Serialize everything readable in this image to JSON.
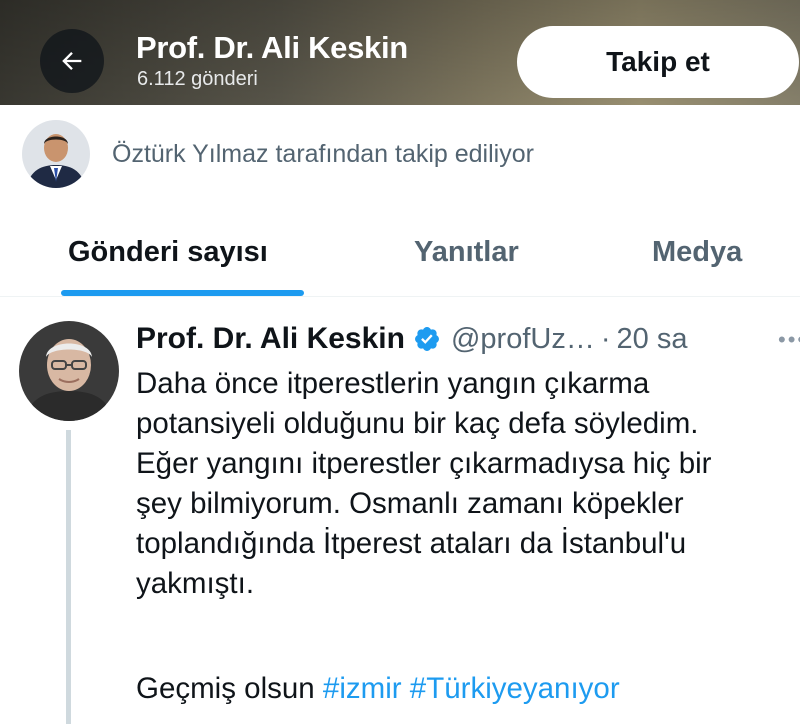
{
  "header": {
    "name": "Prof. Dr. Ali Keskin",
    "post_count": "6.112 gönderi",
    "follow_label": "Takip et"
  },
  "followed_by": {
    "text": "Öztürk Yılmaz tarafından takip ediliyor"
  },
  "tabs": [
    {
      "label": "Gönderi sayısı",
      "active": true
    },
    {
      "label": "Yanıtlar",
      "active": false
    },
    {
      "label": "Medya",
      "active": false
    }
  ],
  "post": {
    "author_name": "Prof. Dr. Ali Keskin",
    "handle": "@profUz…",
    "separator": "·",
    "time": "20 sa",
    "more_icon": "more-dots-icon",
    "text": "Daha önce itperestlerin yangın çıkarma\npotansiyeli olduğunu bir kaç defa söyledim.\nEğer yangını itperestler çıkarmadıysa hiç bir\nşey bilmiyorum. Osmanlı zamanı köpekler\ntoplandığında İtperest ataları da İstanbul'u\nyakmıştı.",
    "closing_text": "Geçmiş olsun",
    "hashtags": [
      "#izmir",
      "#Türkiyeyanıyor"
    ]
  },
  "colors": {
    "accent": "#1d9bf0",
    "secondary_text": "#536471",
    "primary_text": "#0f1419"
  }
}
